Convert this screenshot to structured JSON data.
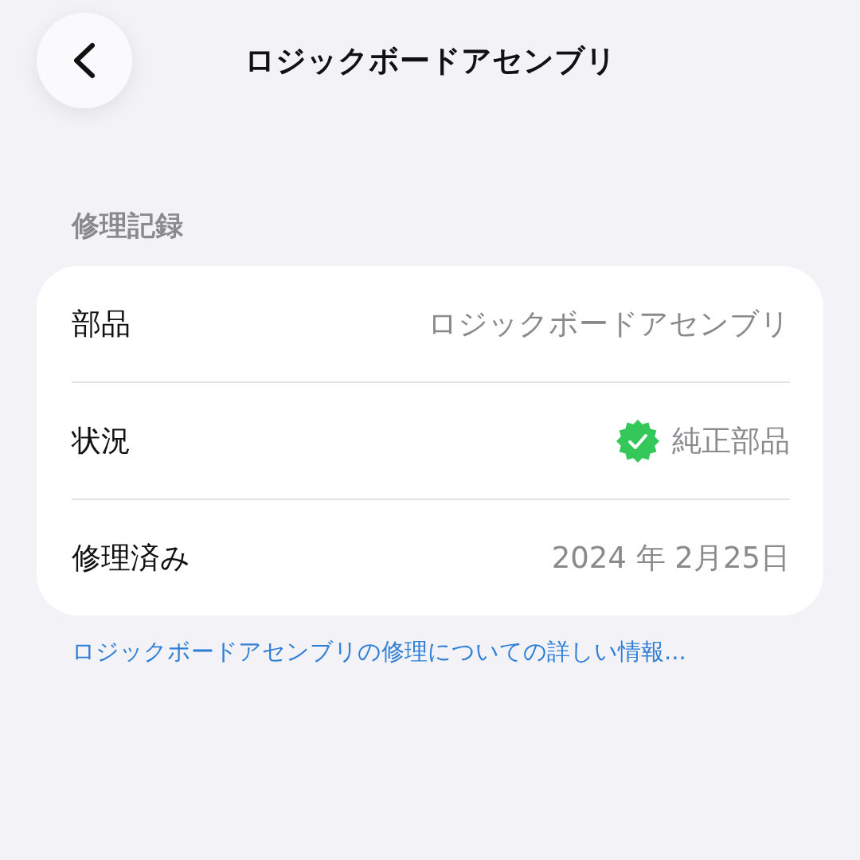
{
  "nav": {
    "title": "ロジックボードアセンブリ"
  },
  "section": {
    "header": "修理記録",
    "rows": [
      {
        "label": "部品",
        "value": "ロジックボードアセンブリ",
        "kind": "text"
      },
      {
        "label": "状況",
        "value": "純正部品",
        "kind": "verified"
      },
      {
        "label": "修理済み",
        "value": "2024 年 2月25日",
        "kind": "text"
      }
    ]
  },
  "link": "ロジックボードアセンブリの修理についての詳しい情報..."
}
